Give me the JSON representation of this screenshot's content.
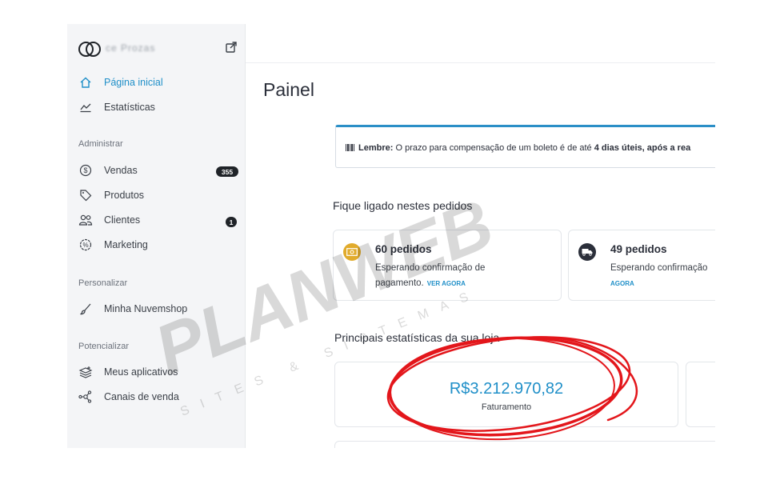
{
  "brand": {
    "name": "ce Prozas"
  },
  "sidebar": {
    "items_top": [
      {
        "label": "Página inicial",
        "icon": "home-icon"
      },
      {
        "label": "Estatísticas",
        "icon": "chart-icon"
      }
    ],
    "section_admin": "Administrar",
    "items_admin": [
      {
        "label": "Vendas",
        "icon": "dollar-icon",
        "badge": "355"
      },
      {
        "label": "Produtos",
        "icon": "tag-icon"
      },
      {
        "label": "Clientes",
        "icon": "users-icon",
        "badge": "1"
      },
      {
        "label": "Marketing",
        "icon": "percent-icon"
      }
    ],
    "section_personalize": "Personalizar",
    "items_personalize": [
      {
        "label": "Minha Nuvemshop",
        "icon": "brush-icon"
      }
    ],
    "section_potential": "Potencializar",
    "items_potential": [
      {
        "label": "Meus aplicativos",
        "icon": "apps-icon"
      },
      {
        "label": "Canais de venda",
        "icon": "channels-icon"
      }
    ]
  },
  "main": {
    "title": "Painel",
    "alert": {
      "strong": "Lembre:",
      "text": " O prazo para compensação de um boleto é de até ",
      "highlight": "4 dias úteis, após a rea"
    },
    "orders_section": "Fique ligado nestes pedidos",
    "orders": [
      {
        "title": "60 pedidos",
        "line1": "Esperando confirmação de",
        "line2": "pagamento.",
        "link": "VER AGORA"
      },
      {
        "title": "49 pedidos",
        "line1": "Esperando confirmação",
        "line2": "",
        "link": "AGORA"
      }
    ],
    "stats_section": "Principais estatísticas da sua loja",
    "stats": [
      {
        "value": "R$3.212.970,82",
        "label": "Faturamento"
      }
    ]
  },
  "watermark": {
    "brand": "PLANWEB",
    "tagline": "SITES & SISTEMAS"
  },
  "colors": {
    "accent": "#1f8fc8",
    "annotation": "#e3161b",
    "badge": "#1f2328"
  }
}
